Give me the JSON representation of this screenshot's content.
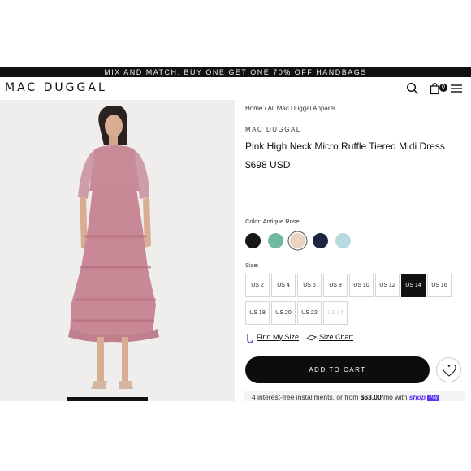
{
  "promo": {
    "text": "MIX AND MATCH: BUY ONE GET ONE 70% OFF HANDBAGS"
  },
  "header": {
    "logo": "MAC DUGGAL",
    "cart_count": "0"
  },
  "breadcrumb": {
    "home": "Home",
    "separator": "/",
    "collection": "All Mac Duggal Apparel"
  },
  "product": {
    "brand": "MAC DUGGAL",
    "title": "Pink High Neck Micro Ruffle Tiered Midi Dress",
    "price": "$698 USD",
    "color_label": "Color: Antique Rose",
    "size_label": "Size:"
  },
  "swatches": [
    {
      "name": "black",
      "hex": "#161616"
    },
    {
      "name": "sage",
      "hex": "#6fb9a1"
    },
    {
      "name": "nude",
      "hex": "#ecd2c0",
      "selected": true
    },
    {
      "name": "navy",
      "hex": "#1d2540"
    },
    {
      "name": "light-blue",
      "hex": "#b7d9e0"
    }
  ],
  "sizes": [
    {
      "label": "US 2"
    },
    {
      "label": "US 4"
    },
    {
      "label": "US 6"
    },
    {
      "label": "US 8"
    },
    {
      "label": "US 10"
    },
    {
      "label": "US 12"
    },
    {
      "label": "US 14",
      "selected": true
    },
    {
      "label": "US 16"
    },
    {
      "label": "US 18"
    },
    {
      "label": "US 20"
    },
    {
      "label": "US 22"
    },
    {
      "label": "US 24",
      "disabled": true
    }
  ],
  "help": {
    "find_size": "Find My Size",
    "size_chart": "Size Chart"
  },
  "actions": {
    "add_to_cart": "ADD TO CART"
  },
  "installments": {
    "prefix": "4 interest-free installments, or from",
    "amount": "$63.00",
    "suffix": "/mo with",
    "shop": "shop",
    "pay": "Pay"
  },
  "icons": [
    "search-icon",
    "shopping-bag-icon",
    "menu-icon",
    "heart-icon",
    "tape-measure-icon",
    "ruler-icon"
  ]
}
